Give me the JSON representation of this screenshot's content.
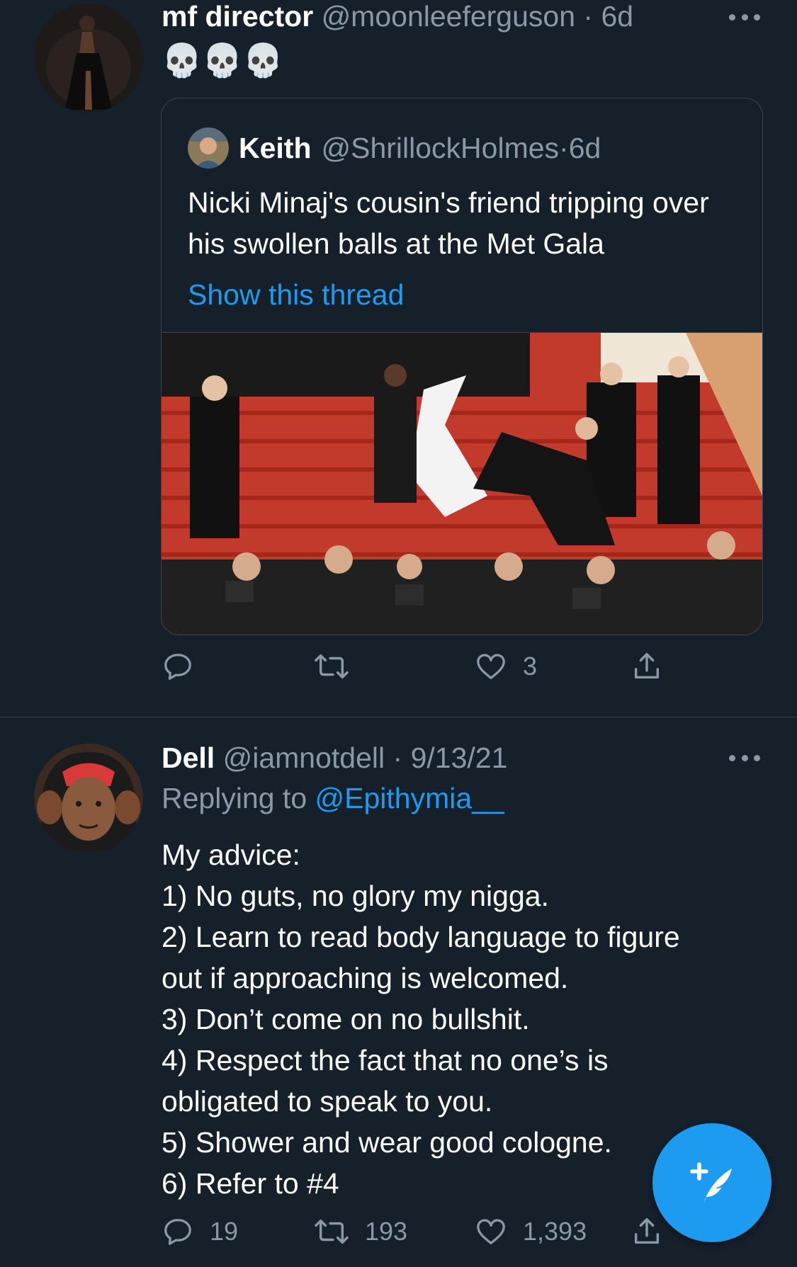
{
  "tweet1": {
    "name": "mf director",
    "handle": "@moonleeferguson",
    "separator": "·",
    "time": "6d",
    "body": "💀💀💀",
    "quote": {
      "name": "Keith",
      "handle": "@ShrillockHolmes",
      "separator": "·",
      "time": "6d",
      "text": "Nicki Minaj's cousin's friend tripping over his swollen balls at the Met Gala",
      "show_thread": "Show this thread"
    },
    "actions": {
      "reply": "",
      "retweet": "",
      "like": "3"
    }
  },
  "tweet2": {
    "name": "Dell",
    "handle": "@iamnotdell",
    "separator": "·",
    "time": "9/13/21",
    "replying_to_label": "Replying to",
    "replying_to_handle": "@Epithymia__",
    "lines": [
      "My advice:",
      "1) No guts, no glory my nigga.",
      "2) Learn to read body language to figure",
      "out if approaching is welcomed.",
      "3) Don’t come on no bullshit.",
      "4) Respect the fact that no one’s is",
      "obligated to speak to you.",
      "5) Shower and wear good cologne.",
      "6) Refer to #4"
    ],
    "actions": {
      "reply": "19",
      "retweet": "193",
      "like": "1,393"
    }
  },
  "icons": {
    "reply": "reply-icon",
    "retweet": "retweet-icon",
    "like": "heart-icon",
    "share": "share-icon",
    "compose": "compose-tweet-icon",
    "more": "more-icon"
  },
  "colors": {
    "background": "#15202b",
    "text": "#ffffff",
    "secondary": "#8b98a5",
    "accent": "#1d9bf0",
    "border": "#38444d"
  }
}
